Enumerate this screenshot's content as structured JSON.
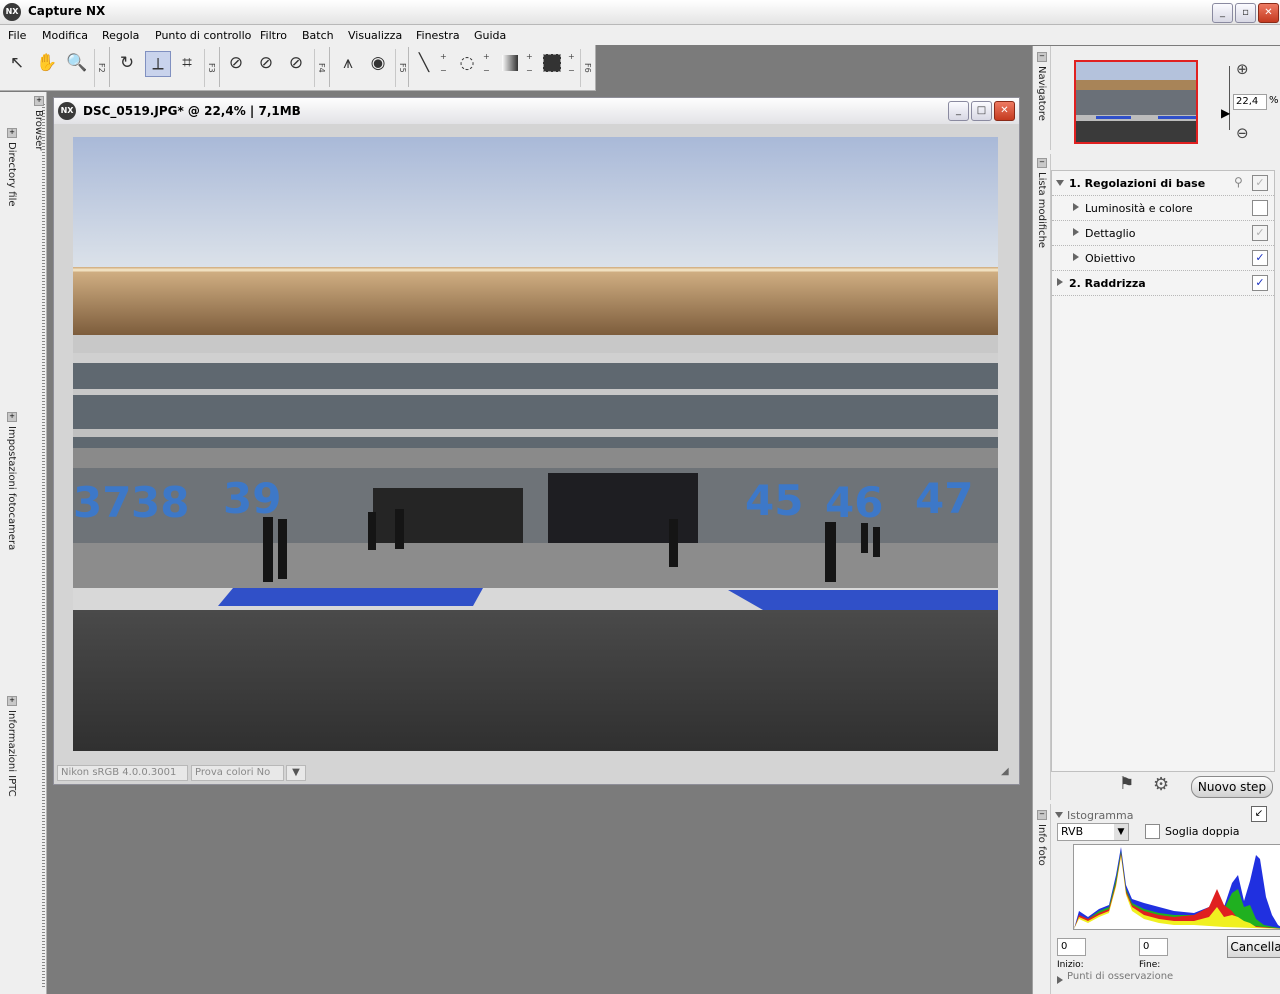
{
  "app": {
    "title": "Capture NX",
    "logo": "NX"
  },
  "window_controls": {
    "minimize": "_",
    "restore": "▫",
    "close": "✕"
  },
  "menu": [
    "File",
    "Modifica",
    "Regola",
    "Punto di controllo",
    "Filtro",
    "Batch",
    "Visualizza",
    "Finestra",
    "Guida"
  ],
  "toolbar": {
    "fkeys": [
      "F2",
      "F3",
      "F4",
      "F5",
      "F6"
    ],
    "plus": "+",
    "minus": "−"
  },
  "left_sidebar": {
    "tabs": [
      "Browser",
      "Directory file",
      "Impostazioni fotocamera",
      "Informazioni IPTC"
    ]
  },
  "document": {
    "logo": "NX",
    "title": "DSC_0519.JPG* @ 22,4% | 7,1MB",
    "status_profile": "Nikon sRGB 4.0.0.3001",
    "status_proof": "Prova colori No",
    "controls": {
      "minimize": "_",
      "maximize": "□",
      "close": "✕"
    },
    "photo_labels": [
      "37",
      "38",
      "39",
      "45",
      "46",
      "47"
    ]
  },
  "navigator": {
    "tab": "Navigatore",
    "zoom_value": "22,4",
    "zoom_unit": "%"
  },
  "edit_list": {
    "tab": "Lista modifiche",
    "steps": [
      {
        "label": "1. Regolazioni di base",
        "bold_prefix": "1.",
        "check": "✓",
        "checked": "grey"
      },
      {
        "label": "Luminosità e colore",
        "check": "",
        "checked": "none"
      },
      {
        "label": "Dettaglio",
        "check": "✓",
        "checked": "grey"
      },
      {
        "label": "Obiettivo",
        "check": "✓",
        "checked": "blue"
      },
      {
        "label": "2. Raddrizza",
        "check": "✓",
        "checked": "blue"
      }
    ],
    "new_step_button": "Nuovo step"
  },
  "histogram": {
    "tab": "Info foto",
    "title": "Istogramma",
    "channel": "RVB",
    "dual_threshold_label": "Soglia doppia",
    "start_value": "0",
    "end_value": "0",
    "start_label": "Inizio:",
    "end_label": "Fine:",
    "cancel_button": "Cancella",
    "watch_points_label": "Punti di osservazione"
  }
}
